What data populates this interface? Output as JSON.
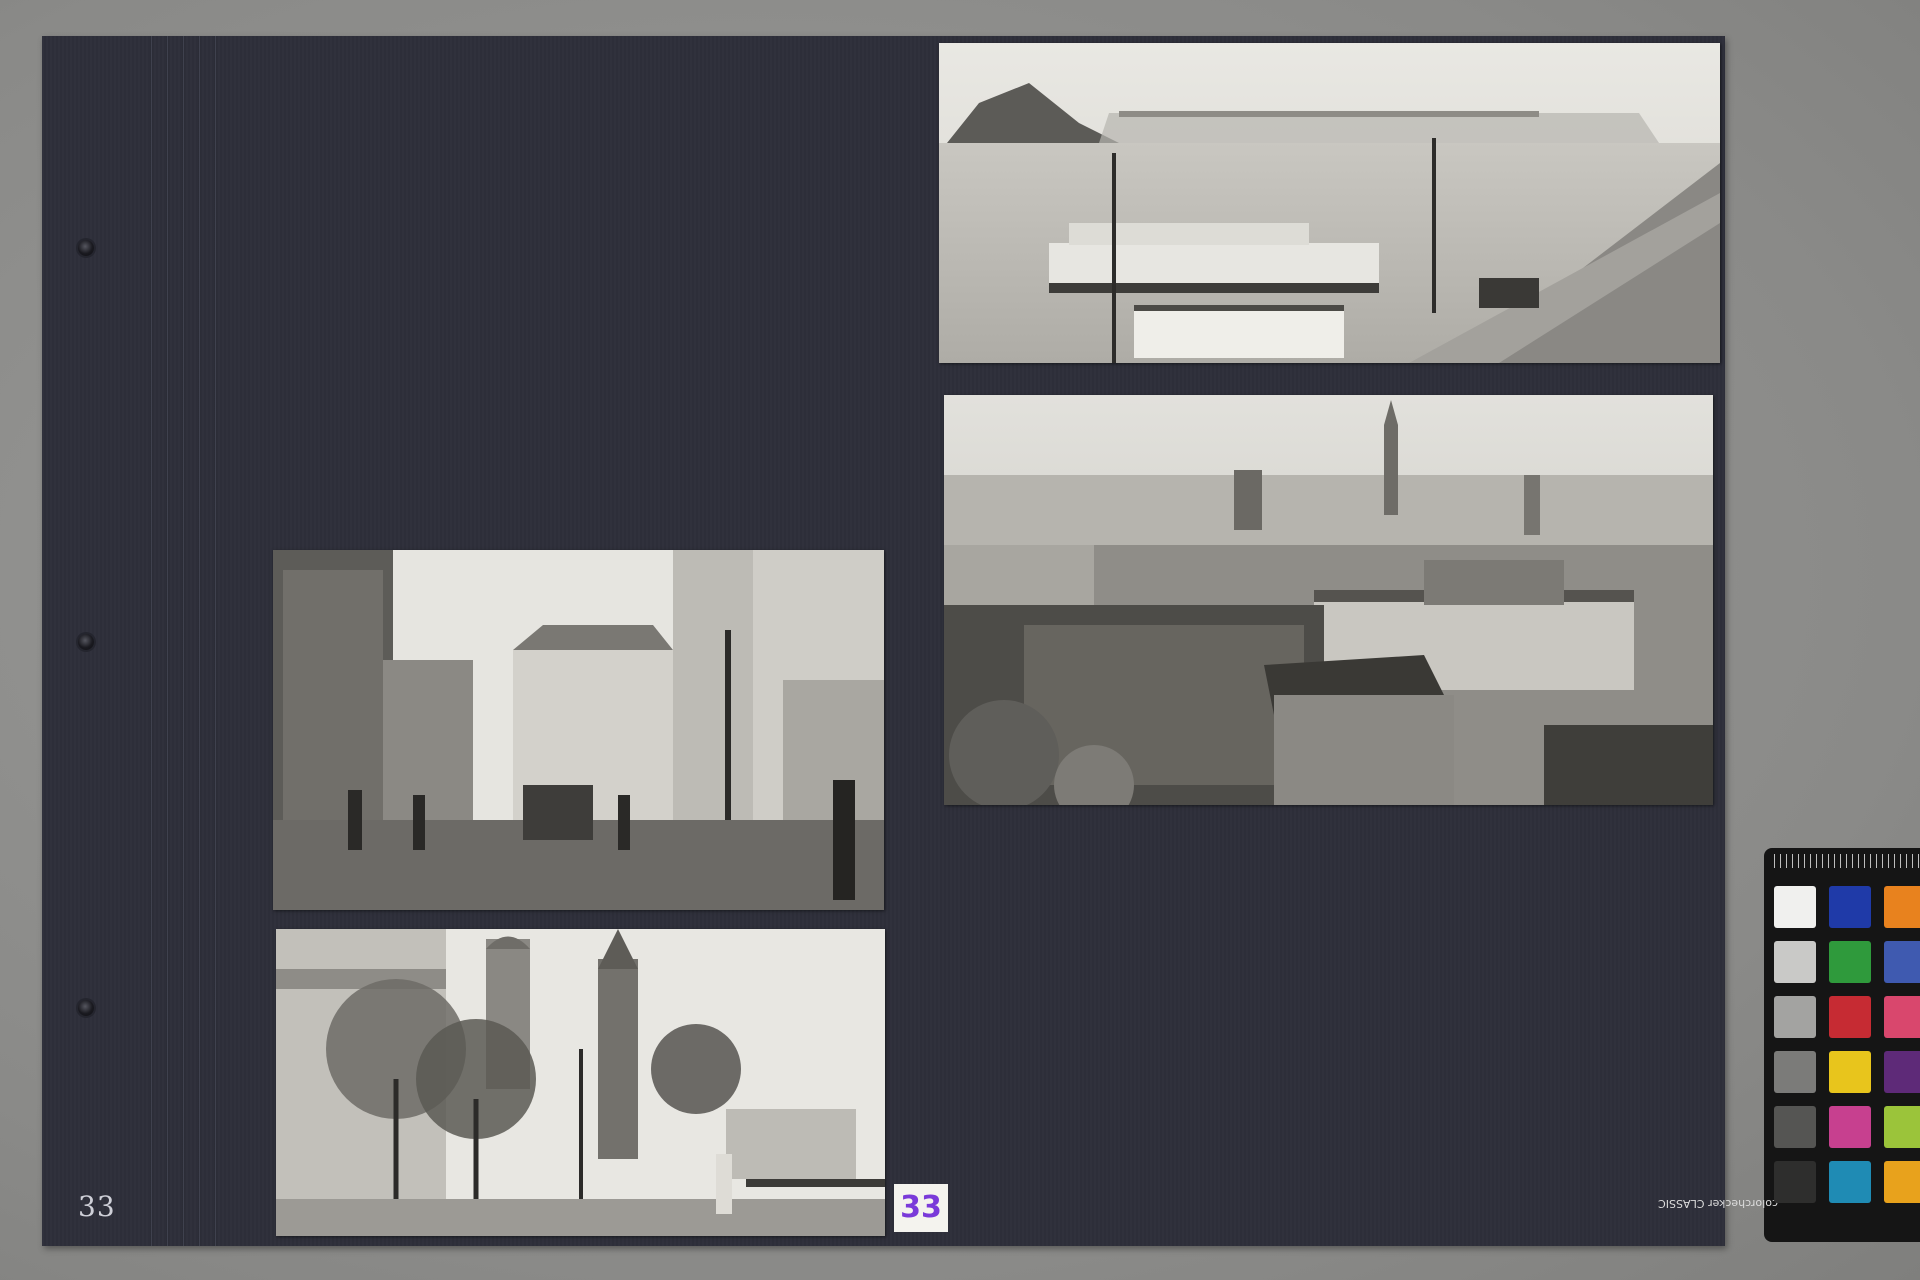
{
  "album": {
    "page_number_handwritten": "33",
    "page_label": "33"
  },
  "photos": [
    {
      "id": "river-embankment-steamers"
    },
    {
      "id": "city-aerial-panorama"
    },
    {
      "id": "pedestrian-street"
    },
    {
      "id": "church-towers-promenade"
    }
  ],
  "colorchecker": {
    "brand": "colorchecker CLASSIC",
    "swatches": [
      [
        "#f0f0ee",
        "#1f3aa8",
        "#e8821e"
      ],
      [
        "#c9c9c7",
        "#2f9a3c",
        "#3f5ab0"
      ],
      [
        "#a3a3a1",
        "#c62b33",
        "#d9476d"
      ],
      [
        "#7b7b79",
        "#e8c51c",
        "#5e2a78"
      ],
      [
        "#555553",
        "#c7408f",
        "#9bc43a"
      ],
      [
        "#2e2e2d",
        "#1f8bb4",
        "#e8a21c"
      ]
    ]
  }
}
